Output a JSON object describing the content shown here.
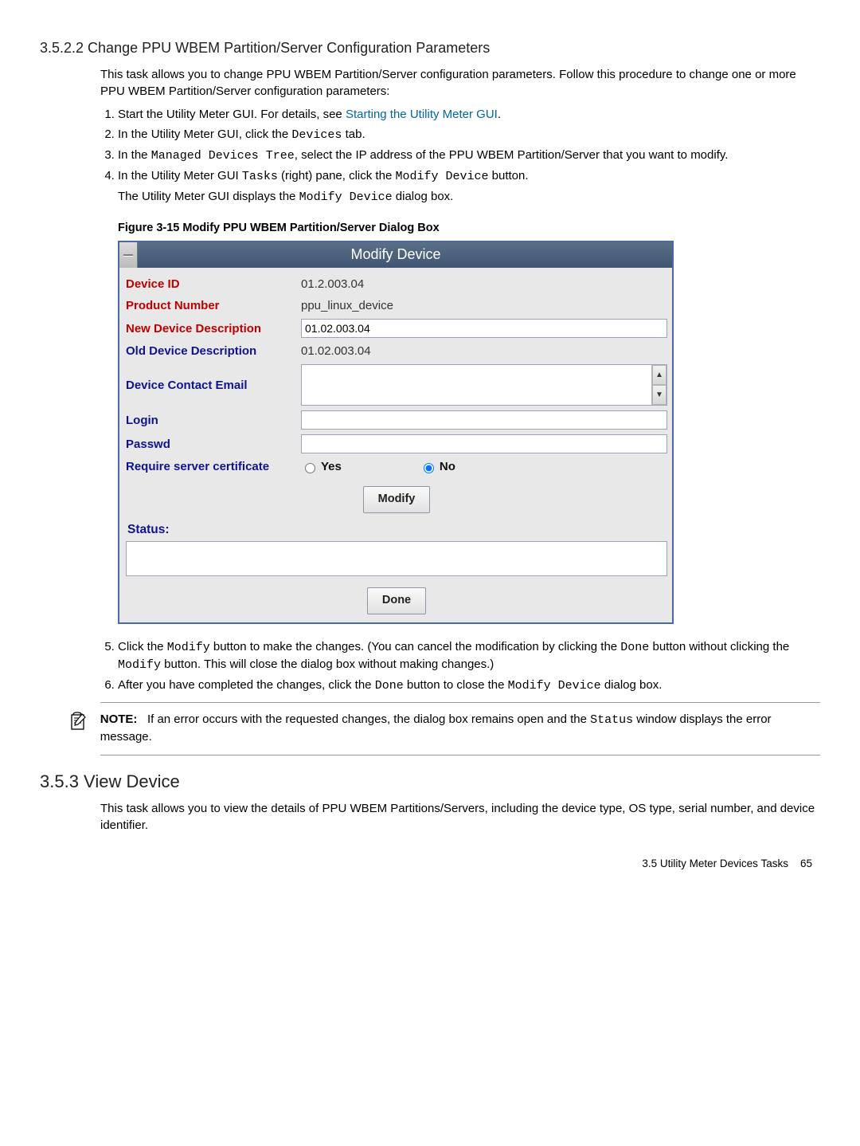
{
  "section1": {
    "heading": "3.5.2.2 Change PPU WBEM Partition/Server Configuration Parameters",
    "intro": "This task allows you to change PPU WBEM Partition/Server configuration parameters. Follow this procedure to change one or more PPU WBEM Partition/Server configuration parameters:",
    "step1_a": "Start the Utility Meter GUI. For details, see ",
    "step1_link": "Starting the Utility Meter GUI",
    "step1_b": ".",
    "step2_a": "In the Utility Meter GUI, click the ",
    "step2_code": "Devices",
    "step2_b": " tab.",
    "step3_a": "In the ",
    "step3_code": "Managed Devices Tree",
    "step3_b": ", select the IP address of the PPU WBEM Partition/Server that you want to modify.",
    "step4_a": "In the Utility Meter GUI ",
    "step4_code1": "Tasks",
    "step4_b": " (right) pane, click the ",
    "step4_code2": "Modify Device",
    "step4_c": " button.",
    "step4_p2_a": "The Utility Meter GUI displays the ",
    "step4_p2_code": "Modify Device",
    "step4_p2_b": " dialog box.",
    "fig_caption": "Figure 3-15 Modify PPU WBEM Partition/Server Dialog Box"
  },
  "dialog": {
    "title": "Modify Device",
    "labels": {
      "device_id": "Device ID",
      "product_number": "Product Number",
      "new_desc": "New Device Description",
      "old_desc": "Old Device Description",
      "contact_email": "Device Contact Email",
      "login": "Login",
      "passwd": "Passwd",
      "require_cert": "Require server certificate",
      "yes": "Yes",
      "no": "No",
      "status": "Status:"
    },
    "values": {
      "device_id": "01.2.003.04",
      "product_number": "ppu_linux_device",
      "new_desc": "01.02.003.04",
      "old_desc": "01.02.003.04"
    },
    "buttons": {
      "modify": "Modify",
      "done": "Done"
    }
  },
  "after_dialog": {
    "step5_a": "Click the ",
    "step5_code1": "Modify",
    "step5_b": " button to make the changes. (You can cancel the modification by clicking the ",
    "step5_code2": "Done",
    "step5_c": " button without clicking the ",
    "step5_code3": "Modify",
    "step5_d": " button. This will close the dialog box without making changes.)",
    "step6_a": "After you have completed the changes, click the ",
    "step6_code1": "Done",
    "step6_b": " button to close the ",
    "step6_code2": "Modify Device",
    "step6_c": " dialog box."
  },
  "note": {
    "label": "NOTE:",
    "text_a": "If an error occurs with the requested changes, the dialog box remains open and the ",
    "text_code": "Status",
    "text_b": " window displays the error message."
  },
  "section2": {
    "heading": "3.5.3 View Device",
    "body": "This task allows you to view the details of PPU WBEM Partitions/Servers, including the device type, OS type, serial number, and device identifier."
  },
  "footer": {
    "text": "3.5 Utility Meter Devices Tasks",
    "page": "65"
  }
}
